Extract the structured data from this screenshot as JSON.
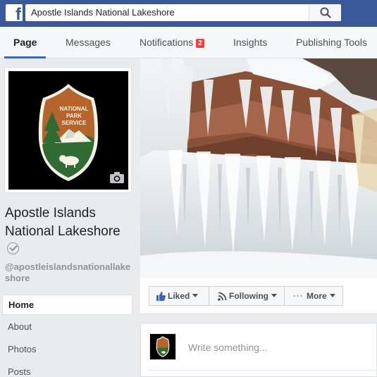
{
  "topbar": {
    "logo": "f",
    "search_value": "Apostle Islands National Lakeshore",
    "search_icon": "search-icon"
  },
  "nav": {
    "tabs": [
      {
        "label": "Page",
        "active": true
      },
      {
        "label": "Messages"
      },
      {
        "label": "Notifications",
        "badge": "2"
      },
      {
        "label": "Insights"
      },
      {
        "label": "Publishing Tools"
      }
    ]
  },
  "logo_patch": {
    "line1": "NATIONAL",
    "line2": "PARK",
    "line3": "SERVICE"
  },
  "profile": {
    "name": "Apostle Islands National Lakeshore",
    "handle": "@apostleislandsnationallakeshore"
  },
  "sidebar": {
    "items": [
      {
        "label": "Home",
        "active": true
      },
      {
        "label": "About"
      },
      {
        "label": "Photos"
      },
      {
        "label": "Posts"
      }
    ]
  },
  "actions": {
    "liked": "Liked",
    "following": "Following",
    "more": "More"
  },
  "composer": {
    "placeholder": "Write something..."
  },
  "colors": {
    "brand": "#3b5998",
    "badge": "#fa3e3e",
    "nps_brown": "#b5652b",
    "nps_green": "#2f6b33"
  }
}
